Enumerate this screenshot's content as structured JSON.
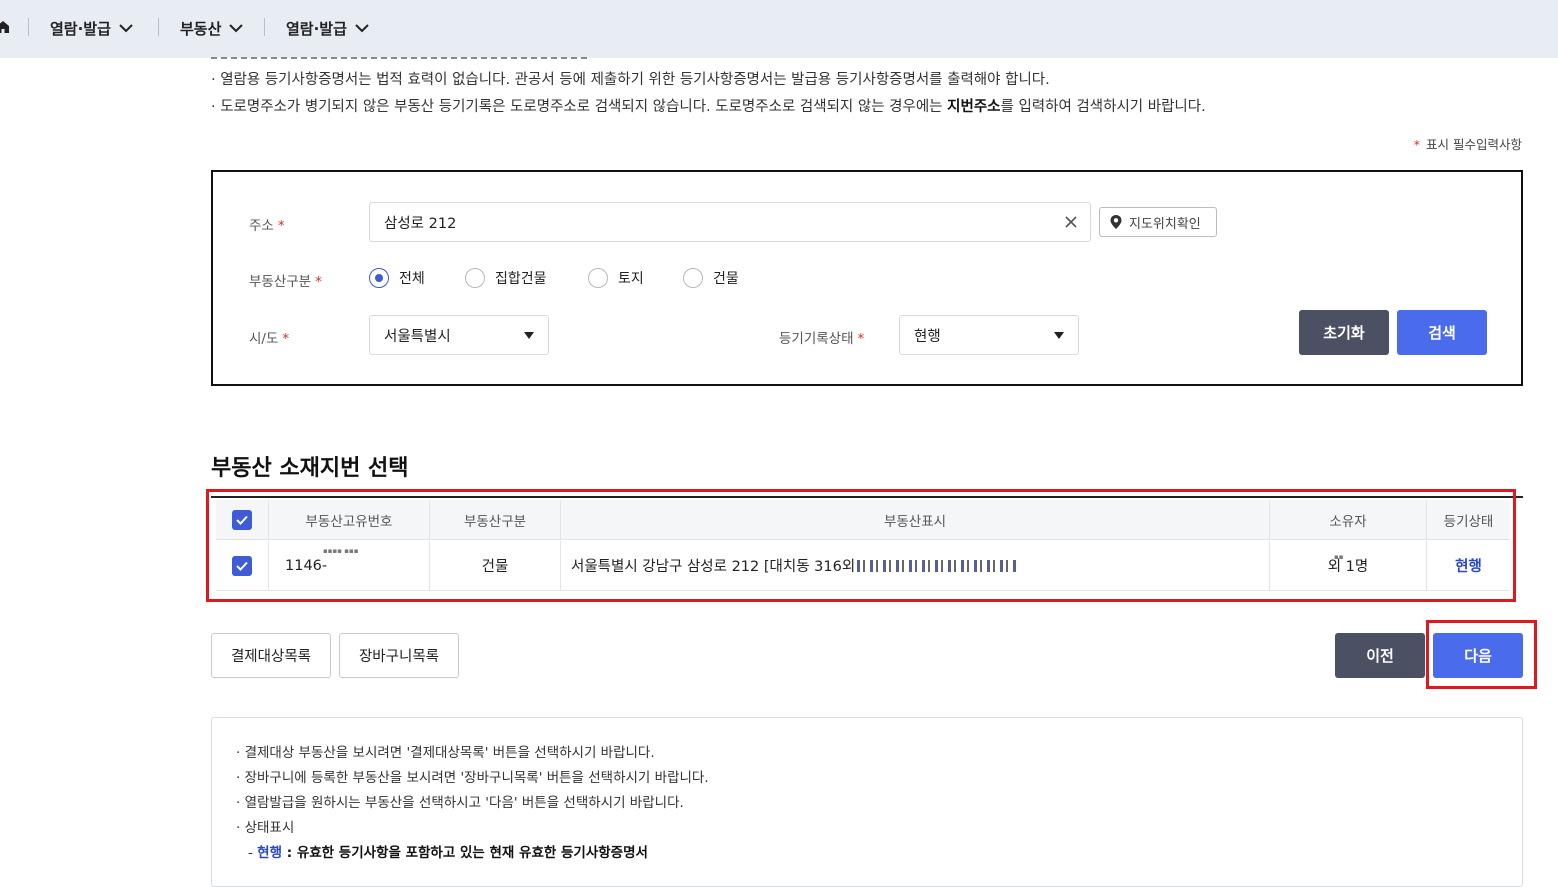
{
  "nav": {
    "items": [
      {
        "label": "열람·발급"
      },
      {
        "label": "부동산"
      },
      {
        "label": "열람·발급"
      }
    ]
  },
  "notices": {
    "line1": "· 열람용 등기사항증명서는 법적 효력이 없습니다. 관공서 등에 제출하기 위한 등기사항증명서는 발급용 등기사항증명서를 출력해야 합니다.",
    "line2_pre": "· 도로명주소가 병기되지 않은 부동산 등기기록은 도로명주소로 검색되지 않습니다. 도로명주소로 검색되지 않는 경우에는 ",
    "line2_bold": "지번주소",
    "line2_post": "를 입력하여 검색하시기 바랍니다."
  },
  "required_note": "표시 필수입력사항",
  "search_form": {
    "address_label": "주소",
    "address_value": "삼성로 212",
    "map_button": "지도위치확인",
    "type_label": "부동산구분",
    "type_options": [
      "전체",
      "집합건물",
      "토지",
      "건물"
    ],
    "type_selected": "전체",
    "sido_label": "시/도",
    "sido_value": "서울특별시",
    "status_label": "등기기록상태",
    "status_value": "현행",
    "reset_button": "초기화",
    "search_button": "검색"
  },
  "results": {
    "title": "부동산 소재지번 선택",
    "columns": [
      "부동산고유번호",
      "부동산구분",
      "부동산표시",
      "소유자",
      "등기상태"
    ],
    "rows": [
      {
        "id": "1146-",
        "type": "건물",
        "location": "서울특별시 강남구 삼성로 212 [대치동 316외",
        "owner": "외 1명",
        "status": "현행"
      }
    ]
  },
  "actions": {
    "payment_list": "결제대상목록",
    "cart_list": "장바구니목록",
    "prev": "이전",
    "next": "다음"
  },
  "info": {
    "line1": "· 결제대상 부동산을 보시려면 '결제대상목록' 버튼을 선택하시기 바랍니다.",
    "line2": "· 장바구니에 등록한 부동산을 보시려면 '장바구니목록' 버튼을 선택하시기 바랍니다.",
    "line3": "· 열람발급을 원하시는 부동산을 선택하시고 '다음' 버튼을 선택하시기 바랍니다.",
    "line4": "· 상태표시",
    "line5_prefix": "- ",
    "line5_blue": "현행",
    "line5_bold": " : 유효한 등기사항을 포함하고 있는 현재 유효한 등기사항증명서"
  },
  "colors": {
    "accent": "#4a6cec",
    "dark_button": "#4b5062",
    "highlight": "#e0191f",
    "required": "#d62b2b"
  }
}
